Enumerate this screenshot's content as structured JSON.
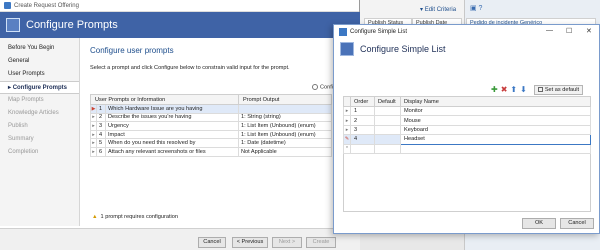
{
  "background": {
    "headers": [
      "Publish Status",
      "Publish Date",
      "Pedido de incidente Genérico"
    ],
    "edit_criteria": "Edit Criteria"
  },
  "wizard": {
    "window_title": "Create Request Offering",
    "banner_title": "Configure Prompts",
    "nav": [
      {
        "label": "Before You Begin",
        "state": "normal"
      },
      {
        "label": "General",
        "state": "normal"
      },
      {
        "label": "User Prompts",
        "state": "normal"
      },
      {
        "label": "Configure Prompts",
        "state": "active"
      },
      {
        "label": "Map Prompts",
        "state": "dim"
      },
      {
        "label": "Knowledge Articles",
        "state": "dim"
      },
      {
        "label": "Publish",
        "state": "dim"
      },
      {
        "label": "Summary",
        "state": "dim"
      },
      {
        "label": "Completion",
        "state": "dim"
      }
    ],
    "section_title": "Configure user prompts",
    "description": "Select a prompt and click Configure below to constrain valid input for the prompt.",
    "configure_label": "Configure",
    "columns": [
      "User Prompts or Information",
      "Prompt Output"
    ],
    "prompts": [
      {
        "index": "1",
        "prompt": "Which Hardware Issue are you having",
        "output": "",
        "selected": true
      },
      {
        "index": "2",
        "prompt": "Describe the issues you're having",
        "output": "1: String (string)",
        "selected": false
      },
      {
        "index": "3",
        "prompt": "Urgency",
        "output": "1: List Item (Unbound) (enum)",
        "selected": false
      },
      {
        "index": "4",
        "prompt": "Impact",
        "output": "1: List Item (Unbound) (enum)",
        "selected": false
      },
      {
        "index": "5",
        "prompt": "When do you need this resolved by",
        "output": "1: Date (datetime)",
        "selected": false
      },
      {
        "index": "6",
        "prompt": "Attach any relevant screenshots or files",
        "output": "Not Applicable",
        "selected": false
      }
    ],
    "warning": "1 prompt requires configuration",
    "buttons": {
      "cancel": "Cancel",
      "previous": "< Previous",
      "next": "Next >",
      "create": "Create"
    }
  },
  "dialog": {
    "title": "Configure Simple List",
    "banner_title": "Configure Simple List",
    "set_default_label": "Set as default",
    "columns": [
      "Order",
      "Default",
      "Display Name"
    ],
    "items": [
      {
        "order": "1",
        "default": "",
        "name": "Monitor",
        "selected": false
      },
      {
        "order": "2",
        "default": "",
        "name": "Mouse",
        "selected": false
      },
      {
        "order": "3",
        "default": "",
        "name": "Keyboard",
        "selected": false
      },
      {
        "order": "4",
        "default": "",
        "name": "Headset",
        "selected": true
      }
    ],
    "buttons": {
      "ok": "OK",
      "cancel": "Cancel"
    }
  },
  "colors": {
    "banner": "#3f63a6",
    "accent": "#1e4e8c",
    "selection": "#dfe9f8"
  }
}
